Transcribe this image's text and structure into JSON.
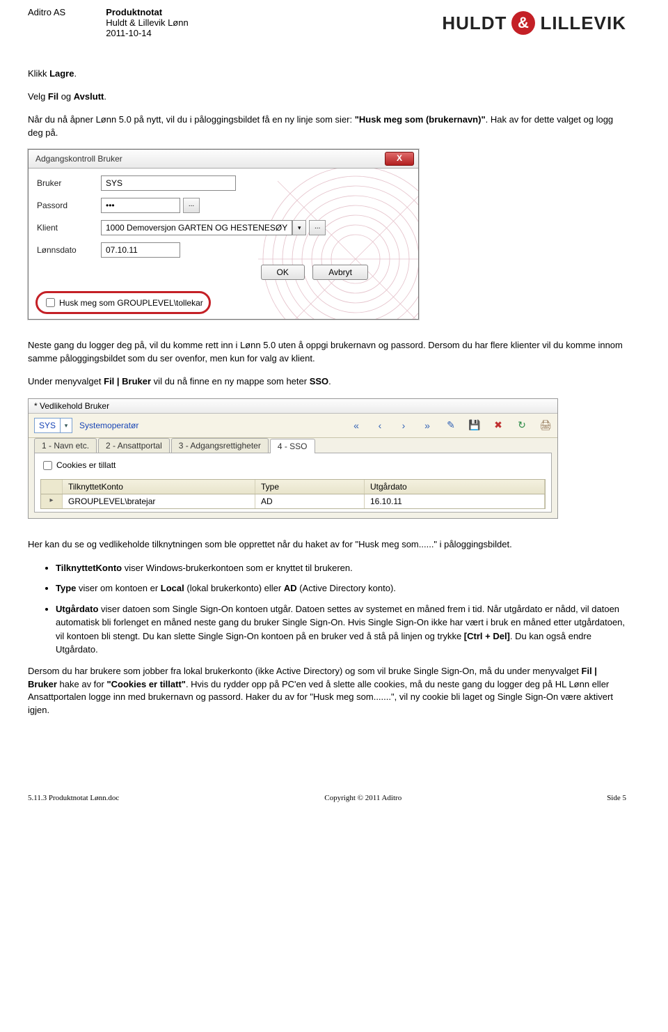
{
  "header": {
    "company": "Aditro AS",
    "title": "Produktnotat",
    "product": "Huldt & Lillevik Lønn",
    "date": "2011-10-14",
    "logo_left": "HULDT",
    "logo_amp": "&",
    "logo_right": "LILLEVIK"
  },
  "intro": {
    "p1a": "Klikk ",
    "p1b": "Lagre",
    "p1c": ".",
    "p2a": "Velg ",
    "p2b": "Fil",
    "p2c": " og ",
    "p2d": "Avslutt",
    "p2e": ".",
    "p3a": "Når du nå åpner Lønn 5.0 på nytt, vil du i påloggingsbildet få en ny linje som sier: ",
    "p3b": "\"Husk meg som (brukernavn)\"",
    "p3c": ". Hak av for dette valget og logg deg på."
  },
  "shot1": {
    "title": "Adgangskontroll Bruker",
    "close": "X",
    "lbl_bruker": "Bruker",
    "val_bruker": "SYS",
    "lbl_passord": "Passord",
    "val_passord": "•••",
    "lbl_klient": "Klient",
    "val_klient": "1000 Demoversjon GARTEN OG HESTENESØY",
    "lbl_dato": "Lønnsdato",
    "val_dato": "07.10.11",
    "btn_ok": "OK",
    "btn_avbryt": "Avbryt",
    "husk": "Husk meg som GROUPLEVEL\\tollekar",
    "ellipsis": "..."
  },
  "mid": {
    "p1": "Neste gang du logger deg på, vil du komme rett inn i Lønn 5.0 uten å oppgi brukernavn og passord. Dersom du har flere klienter vil du komme innom samme påloggingsbildet som du ser ovenfor, men kun for valg av klient.",
    "p2a": "Under menyvalget ",
    "p2b": "Fil | Bruker",
    "p2c": " vil du nå finne en ny mappe som heter ",
    "p2d": "SSO",
    "p2e": "."
  },
  "shot2": {
    "title": "* Vedlikehold Bruker",
    "combo_val": "SYS",
    "sys_label": "Systemoperatør",
    "tabs": [
      "1 - Navn etc.",
      "2 - Ansattportal",
      "3 - Adgangsrettigheter",
      "4 - SSO"
    ],
    "cookies": "Cookies er tillatt",
    "cols": [
      "TilknyttetKonto",
      "Type",
      "Utgårdato"
    ],
    "row": [
      "GROUPLEVEL\\bratejar",
      "AD",
      "16.10.11"
    ]
  },
  "after": {
    "p1": "Her kan du se og vedlikeholde tilknytningen som ble opprettet når du haket av for \"Husk meg som......\" i påloggingsbildet.",
    "b1a": "TilknyttetKonto",
    "b1b": " viser Windows-brukerkontoen som er knyttet til brukeren.",
    "b2a": "Type",
    "b2b": " viser om kontoen er ",
    "b2c": "Local",
    "b2d": " (lokal brukerkonto) eller ",
    "b2e": "AD",
    "b2f": " (Active Directory konto).",
    "b3a": "Utgårdato",
    "b3b": " viser datoen som Single Sign-On kontoen utgår. Datoen settes av systemet en måned frem i tid. Når utgårdato er nådd, vil datoen automatisk bli forlenget en måned neste gang du bruker Single Sign-On. Hvis Single Sign-On ikke har vært i bruk en måned etter utgårdatoen, vil kontoen bli stengt. Du kan slette Single Sign-On kontoen på en bruker ved å stå på linjen og trykke ",
    "b3c": "[Ctrl + Del]",
    "b3d": ". Du kan også endre Utgårdato.",
    "p2a": "Dersom du har brukere som jobber fra lokal brukerkonto (ikke Active Directory) og som vil bruke Single Sign-On, må du under menyvalget ",
    "p2b": "Fil | Bruker",
    "p2c": " hake av for ",
    "p2d": "\"Cookies er tillatt\"",
    "p2e": ". Hvis du rydder opp på PC'en ved å slette alle cookies, må du neste gang du logger deg på HL Lønn eller Ansattportalen logge inn med brukernavn og passord. Haker du av for \"Husk meg som.......\", vil ny cookie bli laget og Single Sign-On være aktivert igjen."
  },
  "footer": {
    "left": "5.11.3 Produktnotat Lønn.doc",
    "center": "Copyright © 2011 Aditro",
    "right": "Side 5"
  }
}
